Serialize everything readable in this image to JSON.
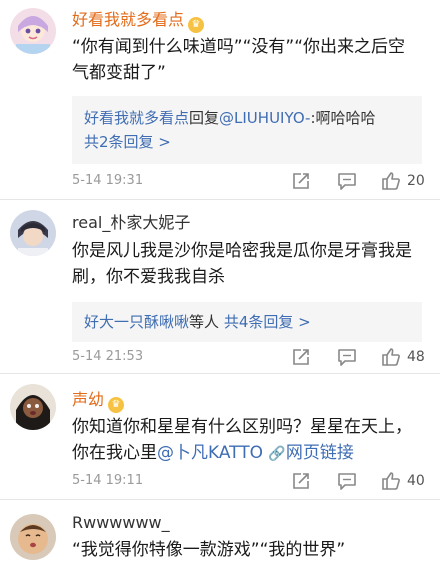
{
  "comments": [
    {
      "username": "好看我就多看点",
      "vip": true,
      "content": "“你有闻到什么味道吗”“没有”“你出来之后空气都变甜了”",
      "reply": {
        "name": "好看我就多看点",
        "connector": "回复",
        "target": "@LIUHUIYO-",
        "text": ":啊哈哈哈",
        "more": "共2条回复 >"
      },
      "date": "5-14 19:31",
      "likes": "20"
    },
    {
      "username": "real_朴家大妮子",
      "vip": false,
      "content": "你是风儿我是沙你是哈密我是瓜你是牙膏我是刷，你不爱我我自杀",
      "reply": {
        "name": "好大一只酥啾啾",
        "connector": "等人",
        "more": "共4条回复 >"
      },
      "date": "5-14 21:53",
      "likes": "48"
    },
    {
      "username": "声幼",
      "vip": true,
      "content": "你知道你和星星有什么区别吗？星星在天上，你在我心里",
      "mention": "@卜凡KATTO",
      "weblink": "网页链接",
      "date": "5-14 19:11",
      "likes": "40"
    },
    {
      "username": "Rwwwwww_",
      "vip": false,
      "content": "“我觉得你特像一款游戏”“我的世界”"
    }
  ],
  "icons": {
    "share": "share-icon",
    "comment": "comment-icon",
    "like": "thumbs-up-icon",
    "vip": "vip-crown-icon",
    "link": "link-icon"
  },
  "colors": {
    "vip_name": "#e36b1a",
    "link": "#3f6db3",
    "reply_bg": "#f5f5f5",
    "meta": "#9a9a9a"
  }
}
